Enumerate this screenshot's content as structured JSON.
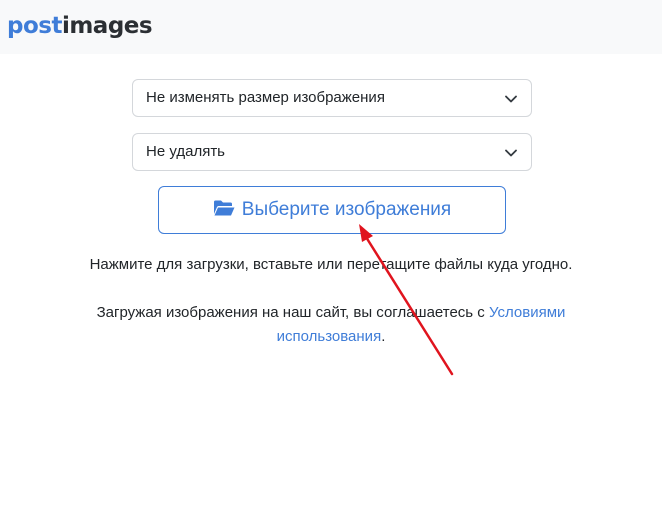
{
  "header": {
    "logo_part1": "post",
    "logo_part2": "images"
  },
  "form": {
    "resize_select": {
      "selected": "Не изменять размер изображения"
    },
    "expire_select": {
      "selected": "Не удалять"
    },
    "upload_button_label": "Выберите изображения"
  },
  "hint_text": "Нажмите для загрузки, вставьте или перетащите файлы куда угодно.",
  "terms": {
    "prefix": "Загружая изображения на наш сайт, вы соглашаетесь с ",
    "link_text": "Условиями использования",
    "suffix": "."
  },
  "icons": {
    "select_arrow": "chevron-down-icon",
    "upload_icon": "folder-open-icon"
  },
  "colors": {
    "accent": "#3f7dd8",
    "annotation_arrow": "#e0141e"
  }
}
